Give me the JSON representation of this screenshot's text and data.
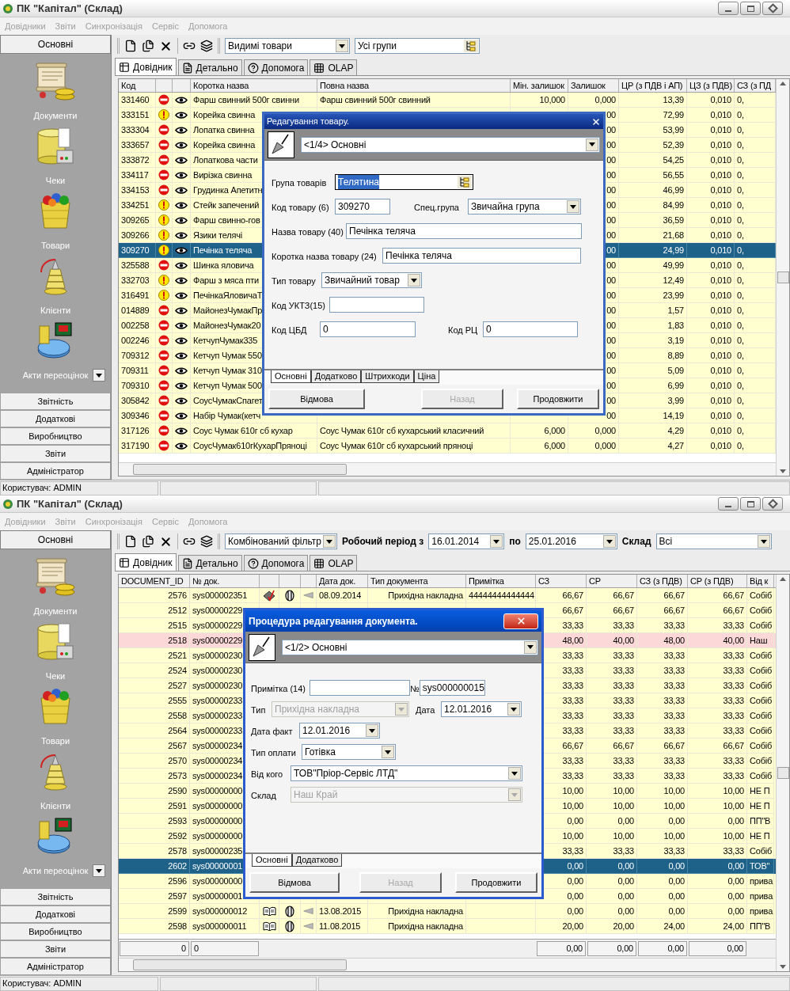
{
  "windows": [
    {
      "title": "ПК \"Капітал\" (Склад)",
      "menu": [
        "Довідники",
        "Звіти",
        "Синхронізація",
        "Сервіс",
        "Допомога"
      ],
      "sidebar": {
        "header": "Основні",
        "items": [
          {
            "label": "Документи",
            "kind": "scroll"
          },
          {
            "label": "Чеки",
            "kind": "register"
          },
          {
            "label": "Товари",
            "kind": "basket"
          },
          {
            "label": "Клієнти",
            "kind": "spring"
          },
          {
            "label": "Акти переоцінок",
            "kind": "disk"
          }
        ],
        "sections": [
          "Звітність",
          "Додаткові",
          "Виробництво",
          "Звіти",
          "Адміністратор"
        ]
      },
      "toolbar": [
        {
          "kind": "combo",
          "value": "Видимі товари"
        },
        {
          "kind": "picker",
          "value": "Усі групи"
        }
      ],
      "tabs": [
        {
          "label": "Довідник",
          "kind": "grid",
          "selected": true
        },
        {
          "label": "Детально",
          "kind": "form",
          "selected": false
        },
        {
          "label": "Допомога",
          "kind": "help",
          "selected": false
        },
        {
          "label": "OLAP",
          "kind": "cube",
          "selected": false
        }
      ],
      "table": {
        "columns": [
          {
            "label": "Код",
            "kind": "text"
          },
          {
            "kind": "icon"
          },
          {
            "kind": "icon"
          },
          {
            "label": "Коротка назва",
            "kind": "text"
          },
          {
            "label": "Повна назва",
            "kind": "text"
          },
          {
            "label": "Мін. залишок",
            "kind": "number"
          },
          {
            "label": "Залишок",
            "kind": "number"
          },
          {
            "label": "ЦР (з ПДВ і АП)",
            "kind": "number"
          },
          {
            "label": "ЦЗ (з ПДВ)",
            "kind": "number"
          },
          {
            "label": "СЗ (з ПД",
            "kind": "text"
          }
        ],
        "rows": [
          {
            "selected": false,
            "kind": "blocked",
            "code": "331460",
            "short_name": "Фарш свинний 500г свинни",
            "full_name": "Фарш свинний 500г свинний",
            "min_stock": "10,000",
            "stock": "0,000",
            "retail_price": "13,39",
            "purchase_price": "0,010",
            "column_10": "0,"
          },
          {
            "selected": false,
            "kind": "warning",
            "code": "333151",
            "short_name": "Корейка свинна",
            "stock": "00",
            "retail_price": "72,99",
            "purchase_price": "0,010",
            "column_10": "0,"
          },
          {
            "selected": false,
            "kind": "blocked",
            "code": "333304",
            "short_name": "Лопатка свинна",
            "stock": "00",
            "retail_price": "53,99",
            "purchase_price": "0,010",
            "column_10": "0,"
          },
          {
            "selected": false,
            "kind": "blocked",
            "code": "333657",
            "short_name": "Корейка свинна",
            "stock": "00",
            "retail_price": "52,39",
            "purchase_price": "0,010",
            "column_10": "0,"
          },
          {
            "selected": false,
            "kind": "blocked",
            "code": "333872",
            "short_name": "Лопаткова части",
            "stock": "00",
            "retail_price": "54,25",
            "purchase_price": "0,010",
            "column_10": "0,"
          },
          {
            "selected": false,
            "kind": "blocked",
            "code": "334117",
            "short_name": "Вирізка свинна",
            "stock": "00",
            "retail_price": "56,55",
            "purchase_price": "0,010",
            "column_10": "0,"
          },
          {
            "selected": false,
            "kind": "blocked",
            "code": "334153",
            "short_name": "Грудинка Апетитн",
            "stock": "00",
            "retail_price": "46,99",
            "purchase_price": "0,010",
            "column_10": "0,"
          },
          {
            "selected": false,
            "kind": "warning",
            "code": "334251",
            "short_name": "Стейк запечений",
            "stock": "00",
            "retail_price": "84,99",
            "purchase_price": "0,010",
            "column_10": "0,"
          },
          {
            "selected": false,
            "kind": "warning",
            "code": "309265",
            "short_name": "Фарш свинно-гов",
            "stock": "00",
            "retail_price": "36,59",
            "purchase_price": "0,010",
            "column_10": "0,"
          },
          {
            "selected": false,
            "kind": "warning",
            "code": "309266",
            "short_name": "Язики телячі",
            "stock": "00",
            "retail_price": "21,68",
            "purchase_price": "0,010",
            "column_10": "0,"
          },
          {
            "selected": true,
            "kind": "warning",
            "code": "309270",
            "short_name": "Печінка теляча",
            "stock": "00",
            "retail_price": "24,99",
            "purchase_price": "0,010",
            "column_10": "0,"
          },
          {
            "selected": false,
            "kind": "blocked",
            "code": "325588",
            "short_name": "Шинка яловича",
            "stock": "00",
            "retail_price": "49,99",
            "purchase_price": "0,010",
            "column_10": "0,"
          },
          {
            "selected": false,
            "kind": "warning",
            "code": "332703",
            "short_name": "Фарш з мяса пти",
            "stock": "00",
            "retail_price": "12,49",
            "purchase_price": "0,010",
            "column_10": "0,"
          },
          {
            "selected": false,
            "kind": "warning",
            "code": "316491",
            "short_name": "ПечінкаЯловичаТ",
            "stock": "00",
            "retail_price": "23,99",
            "purchase_price": "0,010",
            "column_10": "0,"
          },
          {
            "selected": false,
            "kind": "blocked",
            "code": "014889",
            "short_name": "МайонезЧумакПр",
            "stock": "00",
            "retail_price": "1,57",
            "purchase_price": "0,010",
            "column_10": "0,"
          },
          {
            "selected": false,
            "kind": "blocked",
            "code": "002258",
            "short_name": "МайонезЧумак20",
            "stock": "00",
            "retail_price": "1,83",
            "purchase_price": "0,010",
            "column_10": "0,"
          },
          {
            "selected": false,
            "kind": "blocked",
            "code": "002246",
            "short_name": "КетчупЧумак335",
            "stock": "00",
            "retail_price": "3,19",
            "purchase_price": "0,010",
            "column_10": "0,"
          },
          {
            "selected": false,
            "kind": "blocked",
            "code": "709312",
            "short_name": "Кетчуп Чумак 550",
            "stock": "00",
            "retail_price": "8,89",
            "purchase_price": "0,010",
            "column_10": "0,"
          },
          {
            "selected": false,
            "kind": "blocked",
            "code": "709311",
            "short_name": "Кетчуп Чумак 310",
            "stock": "00",
            "retail_price": "5,09",
            "purchase_price": "0,010",
            "column_10": "0,"
          },
          {
            "selected": false,
            "kind": "blocked",
            "code": "709310",
            "short_name": "Кетчуп Чумак 500",
            "stock": "00",
            "retail_price": "6,99",
            "purchase_price": "0,010",
            "column_10": "0,"
          },
          {
            "selected": false,
            "kind": "blocked",
            "code": "305842",
            "short_name": "СоусЧумакСпагет",
            "stock": "00",
            "retail_price": "3,99",
            "purchase_price": "0,010",
            "column_10": "0,"
          },
          {
            "selected": false,
            "kind": "blocked",
            "code": "309346",
            "short_name": "Набір Чумак(кетч",
            "stock": "00",
            "retail_price": "14,19",
            "purchase_price": "0,010",
            "column_10": "0,"
          },
          {
            "selected": false,
            "kind": "blocked",
            "code": "317126",
            "short_name": "Соус Чумак 610г сб кухар",
            "full_name": "Соус Чумак 610г сб кухарський класичний",
            "min_stock": "6,000",
            "stock": "0,000",
            "retail_price": "4,29",
            "purchase_price": "0,010",
            "column_10": "0,"
          },
          {
            "selected": false,
            "kind": "blocked",
            "code": "317190",
            "short_name": "СоусЧумак610гКухарПряноці",
            "full_name": "Соус Чумак 610г сб кухарський пряноці",
            "min_stock": "6,000",
            "stock": "0,000",
            "retail_price": "4,27",
            "purchase_price": "0,010",
            "column_10": "0,"
          }
        ]
      },
      "dialog": {
        "kind": "classic",
        "title": "Редагування товару.",
        "page": "<1/4> Основні",
        "rows": [
          [
            {
              "label": "Група товарів",
              "kind": "picker",
              "value": "Телятина",
              "focused": true,
              "disabled": false
            }
          ],
          [
            {
              "label": "Код товару (6)",
              "kind": "text",
              "value": "309270",
              "focused": false,
              "disabled": false
            },
            {
              "label": "Спец.група",
              "kind": "combo",
              "value": "Звичайна група",
              "focused": false,
              "disabled": false
            }
          ],
          [
            {
              "label": "Назва товару (40)",
              "kind": "text",
              "value": "Печінка теляча",
              "focused": false,
              "disabled": false
            }
          ],
          [
            {
              "label": "Коротка назва товару (24)",
              "kind": "text",
              "value": "Печінка теляча",
              "focused": false,
              "disabled": false
            }
          ],
          [
            {
              "label": "Тип товару",
              "kind": "combo",
              "value": "Звичайний товар",
              "focused": false,
              "disabled": false
            }
          ],
          [
            {
              "label": "Код УКТЗ(15)",
              "kind": "text",
              "focused": false,
              "disabled": false
            }
          ],
          [
            {
              "label": "Код ЦБД",
              "kind": "text",
              "value": "0",
              "focused": false,
              "disabled": false
            },
            {
              "label": "Код РЦ",
              "kind": "text",
              "value": "0",
              "focused": false,
              "disabled": false
            }
          ]
        ],
        "tabs": [
          {
            "label": "Основні",
            "selected": true
          },
          {
            "label": "Додатково",
            "selected": false
          },
          {
            "label": "Штрихкоди",
            "selected": false
          },
          {
            "label": "Ціна",
            "selected": false
          }
        ],
        "buttons": [
          {
            "label": "Відмова",
            "disabled": false
          },
          {
            "label": "Назад",
            "disabled": true
          },
          {
            "label": "Продовжити",
            "disabled": false
          }
        ]
      },
      "status_bar": "Користувач: ADMIN"
    },
    {
      "title": "ПК \"Капітал\" (Склад)",
      "menu": [
        "Довідники",
        "Звіти",
        "Синхронізація",
        "Сервіс",
        "Допомога"
      ],
      "sidebar": {
        "header": "Основні",
        "items": [
          {
            "label": "Документи",
            "kind": "scroll"
          },
          {
            "label": "Чеки",
            "kind": "register"
          },
          {
            "label": "Товари",
            "kind": "basket"
          },
          {
            "label": "Клієнти",
            "kind": "spring"
          },
          {
            "label": "Акти переоцінок",
            "kind": "disk"
          }
        ],
        "sections": [
          "Звітність",
          "Додаткові",
          "Виробництво",
          "Звіти",
          "Адміністратор"
        ]
      },
      "toolbar": [
        {
          "kind": "combo",
          "value": "Комбінований фільтр"
        },
        {
          "kind": "label",
          "value": "Робочий період з"
        },
        {
          "kind": "date",
          "value": "16.01.2014"
        },
        {
          "kind": "label",
          "value": "по"
        },
        {
          "kind": "date",
          "value": "25.01.2016"
        },
        {
          "kind": "label",
          "value": "Склад"
        },
        {
          "kind": "combo",
          "value": "Всі"
        }
      ],
      "tabs": [
        {
          "label": "Довідник",
          "kind": "grid",
          "selected": true
        },
        {
          "label": "Детально",
          "kind": "form",
          "selected": false
        },
        {
          "label": "Допомога",
          "kind": "help",
          "selected": false
        },
        {
          "label": "OLAP",
          "kind": "cube",
          "selected": false
        }
      ],
      "table": {
        "columns": [
          {
            "label": "DOCUMENT_ID",
            "kind": "number"
          },
          {
            "label": "№ док.",
            "kind": "text"
          },
          {
            "kind": "icon"
          },
          {
            "kind": "icon"
          },
          {
            "kind": "icon"
          },
          {
            "label": "Дата док.",
            "kind": "text"
          },
          {
            "label": "Тип документа",
            "kind": "number"
          },
          {
            "label": "Примітка",
            "kind": "text"
          },
          {
            "label": "СЗ",
            "kind": "number"
          },
          {
            "label": "СР",
            "kind": "number"
          },
          {
            "label": "СЗ (з ПДВ)",
            "kind": "number"
          },
          {
            "label": "СР (з ПДВ)",
            "kind": "number"
          },
          {
            "label": "Від к",
            "kind": "text"
          }
        ],
        "rows": [
          {
            "selected": false,
            "flagged": false,
            "kind": "tick",
            "document_id": "2576",
            "number": "sys000002351",
            "date": "08.09.2014",
            "doc_type": "Прихідна накладна",
            "note": "44444444444444",
            "sz": "66,67",
            "sr": "66,67",
            "sz_vat": "66,67",
            "sr_vat": "66,67",
            "from": "Собіб"
          },
          {
            "selected": false,
            "flagged": false,
            "kind": "hidden",
            "document_id": "2512",
            "number": "sys00000229",
            "sz": "66,67",
            "sr": "66,67",
            "sz_vat": "66,67",
            "sr_vat": "66,67",
            "from": "Собіб"
          },
          {
            "selected": false,
            "flagged": false,
            "kind": "hidden",
            "document_id": "2515",
            "number": "sys00000229",
            "sz": "33,33",
            "sr": "33,33",
            "sz_vat": "33,33",
            "sr_vat": "33,33",
            "from": "Собіб"
          },
          {
            "selected": false,
            "flagged": true,
            "kind": "hidden",
            "document_id": "2518",
            "number": "sys00000229",
            "sz": "48,00",
            "sr": "40,00",
            "sz_vat": "48,00",
            "sr_vat": "40,00",
            "from": "Наш"
          },
          {
            "selected": false,
            "flagged": false,
            "kind": "hidden",
            "document_id": "2521",
            "number": "sys00000230",
            "sz": "33,33",
            "sr": "33,33",
            "sz_vat": "33,33",
            "sr_vat": "33,33",
            "from": "Собіб"
          },
          {
            "selected": false,
            "flagged": false,
            "kind": "hidden",
            "document_id": "2524",
            "number": "sys00000230",
            "sz": "33,33",
            "sr": "33,33",
            "sz_vat": "33,33",
            "sr_vat": "33,33",
            "from": "Собіб"
          },
          {
            "selected": false,
            "flagged": false,
            "kind": "hidden",
            "document_id": "2527",
            "number": "sys00000230",
            "sz": "33,33",
            "sr": "33,33",
            "sz_vat": "33,33",
            "sr_vat": "33,33",
            "from": "Собіб"
          },
          {
            "selected": false,
            "flagged": false,
            "kind": "hidden",
            "document_id": "2555",
            "number": "sys00000233",
            "sz": "33,33",
            "sr": "33,33",
            "sz_vat": "33,33",
            "sr_vat": "33,33",
            "from": "Собіб"
          },
          {
            "selected": false,
            "flagged": false,
            "kind": "hidden",
            "document_id": "2558",
            "number": "sys00000233",
            "sz": "33,33",
            "sr": "33,33",
            "sz_vat": "33,33",
            "sr_vat": "33,33",
            "from": "Собіб"
          },
          {
            "selected": false,
            "flagged": false,
            "kind": "hidden",
            "document_id": "2564",
            "number": "sys00000233",
            "sz": "33,33",
            "sr": "33,33",
            "sz_vat": "33,33",
            "sr_vat": "33,33",
            "from": "Собіб"
          },
          {
            "selected": false,
            "flagged": false,
            "kind": "hidden",
            "document_id": "2567",
            "number": "sys00000234",
            "sz": "66,67",
            "sr": "66,67",
            "sz_vat": "66,67",
            "sr_vat": "66,67",
            "from": "Собіб"
          },
          {
            "selected": false,
            "flagged": false,
            "kind": "hidden",
            "document_id": "2570",
            "number": "sys00000234",
            "sz": "33,33",
            "sr": "33,33",
            "sz_vat": "33,33",
            "sr_vat": "33,33",
            "from": "Собіб"
          },
          {
            "selected": false,
            "flagged": false,
            "kind": "hidden",
            "document_id": "2573",
            "number": "sys00000234",
            "sz": "33,33",
            "sr": "33,33",
            "sz_vat": "33,33",
            "sr_vat": "33,33",
            "from": "Собіб"
          },
          {
            "selected": false,
            "flagged": false,
            "kind": "hidden",
            "document_id": "2590",
            "number": "sys00000000",
            "sz": "10,00",
            "sr": "10,00",
            "sz_vat": "10,00",
            "sr_vat": "10,00",
            "from": "НЕ П"
          },
          {
            "selected": false,
            "flagged": false,
            "kind": "hidden",
            "document_id": "2591",
            "number": "sys00000000",
            "sz": "10,00",
            "sr": "10,00",
            "sz_vat": "10,00",
            "sr_vat": "10,00",
            "from": "НЕ П"
          },
          {
            "selected": false,
            "flagged": false,
            "kind": "hidden",
            "document_id": "2593",
            "number": "sys00000000",
            "sz": "0,00",
            "sr": "0,00",
            "sz_vat": "0,00",
            "sr_vat": "0,00",
            "from": "ПП\"В"
          },
          {
            "selected": false,
            "flagged": false,
            "kind": "hidden",
            "document_id": "2592",
            "number": "sys00000000",
            "sz": "10,00",
            "sr": "10,00",
            "sz_vat": "10,00",
            "sr_vat": "10,00",
            "from": "НЕ П"
          },
          {
            "selected": false,
            "flagged": false,
            "kind": "hidden",
            "document_id": "2578",
            "number": "sys00000235",
            "sz": "33,33",
            "sr": "33,33",
            "sz_vat": "33,33",
            "sr_vat": "33,33",
            "from": "Собіб"
          },
          {
            "selected": true,
            "flagged": false,
            "kind": "hidden",
            "document_id": "2602",
            "number": "sys00000001",
            "sz": "0,00",
            "sr": "0,00",
            "sz_vat": "0,00",
            "sr_vat": "0,00",
            "from": "ТОВ\""
          },
          {
            "selected": false,
            "flagged": false,
            "kind": "hidden",
            "document_id": "2596",
            "number": "sys00000000",
            "sz": "0,00",
            "sr": "0,00",
            "sz_vat": "0,00",
            "sr_vat": "0,00",
            "from": "прива"
          },
          {
            "selected": false,
            "flagged": false,
            "kind": "hidden",
            "document_id": "2597",
            "number": "sys00000001",
            "sz": "0,00",
            "sr": "0,00",
            "sz_vat": "0,00",
            "sr_vat": "0,00",
            "from": "прива"
          },
          {
            "selected": false,
            "flagged": false,
            "kind": "book",
            "document_id": "2599",
            "number": "sys000000012",
            "date": "13.08.2015",
            "doc_type": "Прихідна накладна",
            "sz": "0,00",
            "sr": "0,00",
            "sz_vat": "0,00",
            "sr_vat": "0,00",
            "from": "прива"
          },
          {
            "selected": false,
            "flagged": false,
            "kind": "book",
            "document_id": "2598",
            "number": "sys000000011",
            "date": "11.08.2015",
            "doc_type": "Прихідна накладна",
            "sz": "20,00",
            "sr": "20,00",
            "sz_vat": "24,00",
            "sr_vat": "24,00",
            "from": "ПП\"В"
          }
        ],
        "totals": {
          "document_id": "0",
          "number": "0",
          "sz": "0,00",
          "sr": "0,00",
          "sz_vat": "0,00",
          "sr_vat": "0,00"
        }
      },
      "dialog": {
        "kind": "xp",
        "title": "Процедура редагування документа.",
        "page": "<1/2> Основні",
        "rows": [
          [
            {
              "label": "Примітка (14)",
              "kind": "text",
              "focused": false,
              "disabled": false
            },
            {
              "label": "№",
              "kind": "text",
              "value": "sys000000015",
              "focused": false,
              "disabled": false
            }
          ],
          [
            {
              "label": "Тип",
              "kind": "combo",
              "value": "Прихідна накладна",
              "focused": false,
              "disabled": true
            },
            {
              "label": "Дата",
              "kind": "combo",
              "value": "12.01.2016",
              "focused": false,
              "disabled": false
            }
          ],
          [
            {
              "label": "Дата факт",
              "kind": "combo",
              "value": "12.01.2016",
              "focused": false,
              "disabled": false
            }
          ],
          [
            {
              "label": "Тип оплати",
              "kind": "combo",
              "value": "Готівка",
              "focused": false,
              "disabled": false
            }
          ],
          [
            {
              "label": "Від кого",
              "kind": "combo",
              "value": "ТОВ\"Пріор-Сервіс ЛТД\"",
              "focused": false,
              "disabled": false
            }
          ],
          [
            {
              "label": "Склад",
              "kind": "combo",
              "value": "Наш Край",
              "focused": false,
              "disabled": true
            }
          ]
        ],
        "tabs": [
          {
            "label": "Основні",
            "selected": true
          },
          {
            "label": "Додатково",
            "selected": false
          }
        ],
        "buttons": [
          {
            "label": "Відмова",
            "disabled": false
          },
          {
            "label": "Назад",
            "disabled": true
          },
          {
            "label": "Продовжити",
            "disabled": false
          }
        ]
      },
      "status_bar": "Користувач: ADMIN"
    }
  ]
}
